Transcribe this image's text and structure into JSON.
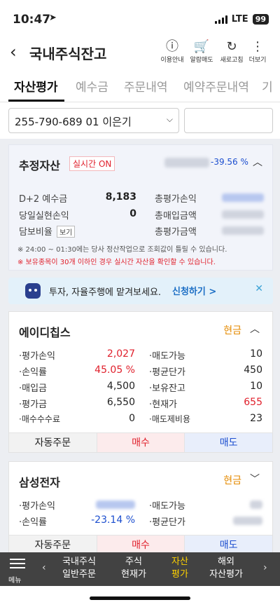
{
  "status": {
    "time": "10:47",
    "network": "LTE",
    "battery": "99"
  },
  "header": {
    "title": "국내주식잔고",
    "buttons": [
      {
        "icon": "info-icon",
        "glyph": "ⓘ",
        "label": "이용안내"
      },
      {
        "icon": "cart-icon",
        "glyph": "🛒",
        "label": "알람매도"
      },
      {
        "icon": "refresh-icon",
        "glyph": "↻",
        "label": "새로고침"
      },
      {
        "icon": "more-icon",
        "glyph": "⋮",
        "label": "더보기"
      }
    ]
  },
  "tabs": [
    "자산평가",
    "예수금",
    "주문내역",
    "예약주문내역",
    "기"
  ],
  "account": {
    "number": "255-790-689 01",
    "owner": "이은기"
  },
  "summary": {
    "title": "추정자산",
    "live_label": "실시간",
    "live_state": "ON",
    "rate": "-39.56 %",
    "left": [
      {
        "label": "D+2 예수금",
        "value": "8,183"
      },
      {
        "label": "당일실현손익",
        "value": "0"
      },
      {
        "label": "담보비율",
        "button": "보기"
      }
    ],
    "right": [
      {
        "label": "총평가손익"
      },
      {
        "label": "총매입금액"
      },
      {
        "label": "총평가금액"
      }
    ],
    "note1": "※ 24:00 ~ 01:30에는 당사 정산작업으로 조회값이 틀릴 수 있습니다.",
    "note2": "※ 보유종목이 30개 이하인 경우 실시간 자산을 확인할 수 있습니다."
  },
  "banner": {
    "text": "투자, 자율주행에 맡겨보세요.",
    "link": "신청하기 >"
  },
  "stocks": [
    {
      "name": "에이디칩스",
      "type": "현금",
      "left": [
        {
          "label": "·평가손익",
          "value": "2,027",
          "color": "red"
        },
        {
          "label": "·손익률",
          "value": "45.05 %",
          "color": "red"
        },
        {
          "label": "·매입금",
          "value": "4,500",
          "color": ""
        },
        {
          "label": "·평가금",
          "value": "6,550",
          "color": ""
        },
        {
          "label": "·매수수수료",
          "value": "0",
          "color": ""
        }
      ],
      "right": [
        {
          "label": "·매도가능",
          "value": "10",
          "color": ""
        },
        {
          "label": "·평균단가",
          "value": "450",
          "color": ""
        },
        {
          "label": "·보유잔고",
          "value": "10",
          "color": ""
        },
        {
          "label": "·현재가",
          "value": "655",
          "color": "red"
        },
        {
          "label": "·매도제비용",
          "value": "23",
          "color": ""
        }
      ],
      "buttons": {
        "auto": "자동주문",
        "buy": "매수",
        "sell": "매도"
      }
    },
    {
      "name": "삼성전자",
      "type": "현금",
      "left": [
        {
          "label": "·평가손익",
          "value": "",
          "color": "blue"
        },
        {
          "label": "·손익률",
          "value": "-23.14 %",
          "color": "blue"
        }
      ],
      "right": [
        {
          "label": "·매도가능",
          "value": "",
          "color": ""
        },
        {
          "label": "·평균단가",
          "value": "",
          "color": ""
        }
      ],
      "buttons": {
        "auto": "자동주문",
        "buy": "매수",
        "sell": "매도"
      }
    }
  ],
  "bottom_nav": {
    "menu": "메뉴",
    "items": [
      {
        "line1": "국내주식",
        "line2": "일반주문"
      },
      {
        "line1": "주식",
        "line2": "현재가"
      },
      {
        "line1": "자산",
        "line2": "평가"
      },
      {
        "line1": "해외",
        "line2": "자산평가"
      }
    ]
  },
  "colors": {
    "accent_red": "#e0202c",
    "accent_blue": "#1d4fcf",
    "cash_orange": "#e58a00",
    "nav_active": "#ffd200"
  }
}
